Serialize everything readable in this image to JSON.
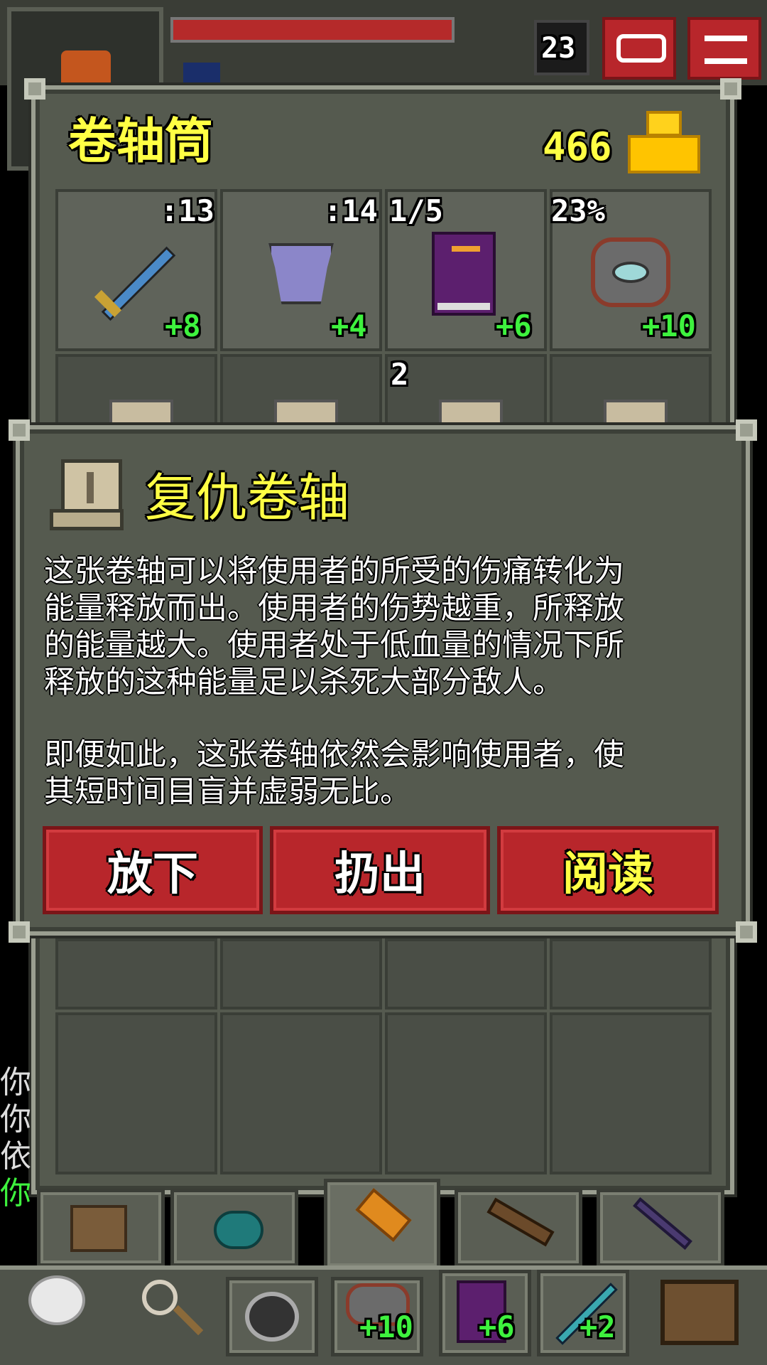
{
  "hud": {
    "depth": "23"
  },
  "bag": {
    "title": "卷轴筒",
    "gold": "466",
    "equip_slots": [
      {
        "name": "sword",
        "top_label": ":13",
        "bonus": "+8"
      },
      {
        "name": "armor",
        "top_label": ":14",
        "bonus": "+4"
      },
      {
        "name": "book",
        "top_label": "1/5",
        "bonus": "+6"
      },
      {
        "name": "shield",
        "top_label": "23%",
        "bonus": "+10"
      }
    ],
    "scroll_count": "2"
  },
  "item": {
    "title": "复仇卷轴",
    "description_1": "这张卷轴可以将使用者的所受的伤痛转化为\n能量释放而出。使用者的伤势越重，所释放\n的能量越大。使用者处于低血量的情况下所\n释放的这种能量足以杀死大部分敌人。",
    "description_2": "即便如此，这张卷轴依然会影响使用者，使\n其短时间目盲并虚弱无比。",
    "buttons": {
      "drop": "放下",
      "throw": "扔出",
      "read": "阅读"
    }
  },
  "quickbar": {
    "shield_bonus": "+10",
    "book_bonus": "+6",
    "wand_bonus": "+2"
  },
  "log": {
    "lines": [
      "你",
      "你",
      "依",
      "你"
    ]
  },
  "colors": {
    "panel_bg": "#555a4f",
    "button_red": "#b8262b",
    "title_yellow": "#ffff44",
    "bonus_green": "#3ef23e"
  }
}
